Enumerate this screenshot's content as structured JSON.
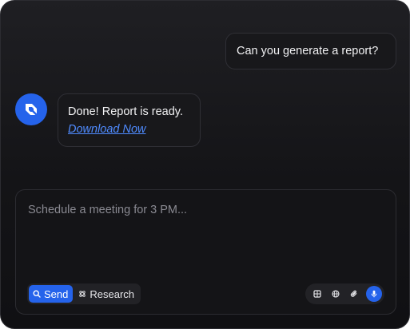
{
  "conversation": {
    "user_message": "Can you generate a report?",
    "bot_message": "Done! Report is ready.",
    "bot_link": "Download Now"
  },
  "composer": {
    "placeholder": "Schedule a meeting for 3 PM...",
    "value": "",
    "modes": [
      {
        "label": "Send",
        "icon": "search-icon",
        "active": true
      },
      {
        "label": "Research",
        "icon": "atom-icon",
        "active": false
      }
    ],
    "tools": [
      {
        "icon": "grid-icon"
      },
      {
        "icon": "globe-icon"
      },
      {
        "icon": "paperclip-icon"
      },
      {
        "icon": "microphone-icon"
      }
    ]
  },
  "colors": {
    "accent": "#2563eb",
    "link": "#4f8bff",
    "background": "#141417",
    "bubble": "#18181b"
  }
}
